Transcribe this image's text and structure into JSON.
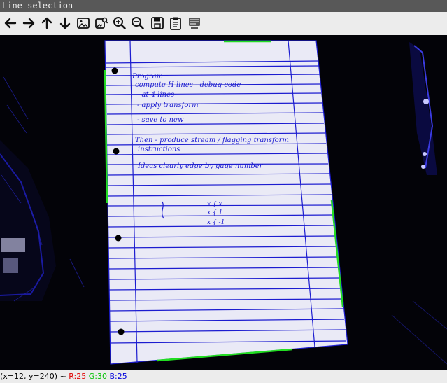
{
  "window": {
    "title": "Line selection"
  },
  "toolbar": {
    "buttons": [
      {
        "name": "pan-left-button",
        "icon": "arrow-left-icon"
      },
      {
        "name": "pan-right-button",
        "icon": "arrow-right-icon"
      },
      {
        "name": "pan-up-button",
        "icon": "arrow-up-icon"
      },
      {
        "name": "pan-down-button",
        "icon": "arrow-down-icon"
      },
      {
        "name": "zoom-fit-button",
        "icon": "image-icon"
      },
      {
        "name": "zoom-original-button",
        "icon": "image-zoom-icon"
      },
      {
        "name": "zoom-in-button",
        "icon": "zoom-in-icon"
      },
      {
        "name": "zoom-out-button",
        "icon": "zoom-out-icon"
      },
      {
        "name": "save-button",
        "icon": "save-icon"
      },
      {
        "name": "copy-clipboard-button",
        "icon": "clipboard-icon"
      },
      {
        "name": "properties-button",
        "icon": "properties-icon"
      }
    ]
  },
  "notes": {
    "lines": [
      "Program",
      "compute H lines     - debug code",
      "- at 4 lines",
      "- apply transform",
      "- save to new",
      "Then - produce stream / flagging transform",
      "instructions",
      "Ideas clearly edge by gage number",
      "x { x",
      "x { 1",
      "x { -1"
    ]
  },
  "status": {
    "coords": "(x=12, y=240) ~",
    "r": "R:25",
    "g": "G:30",
    "b": "B:25"
  },
  "colors": {
    "red": "#e00000",
    "green": "#00c000",
    "blue": "#0000dd",
    "paper": "#eaeaf6",
    "ink": "#1c1cd0",
    "detected_edge": "#22dd22"
  }
}
